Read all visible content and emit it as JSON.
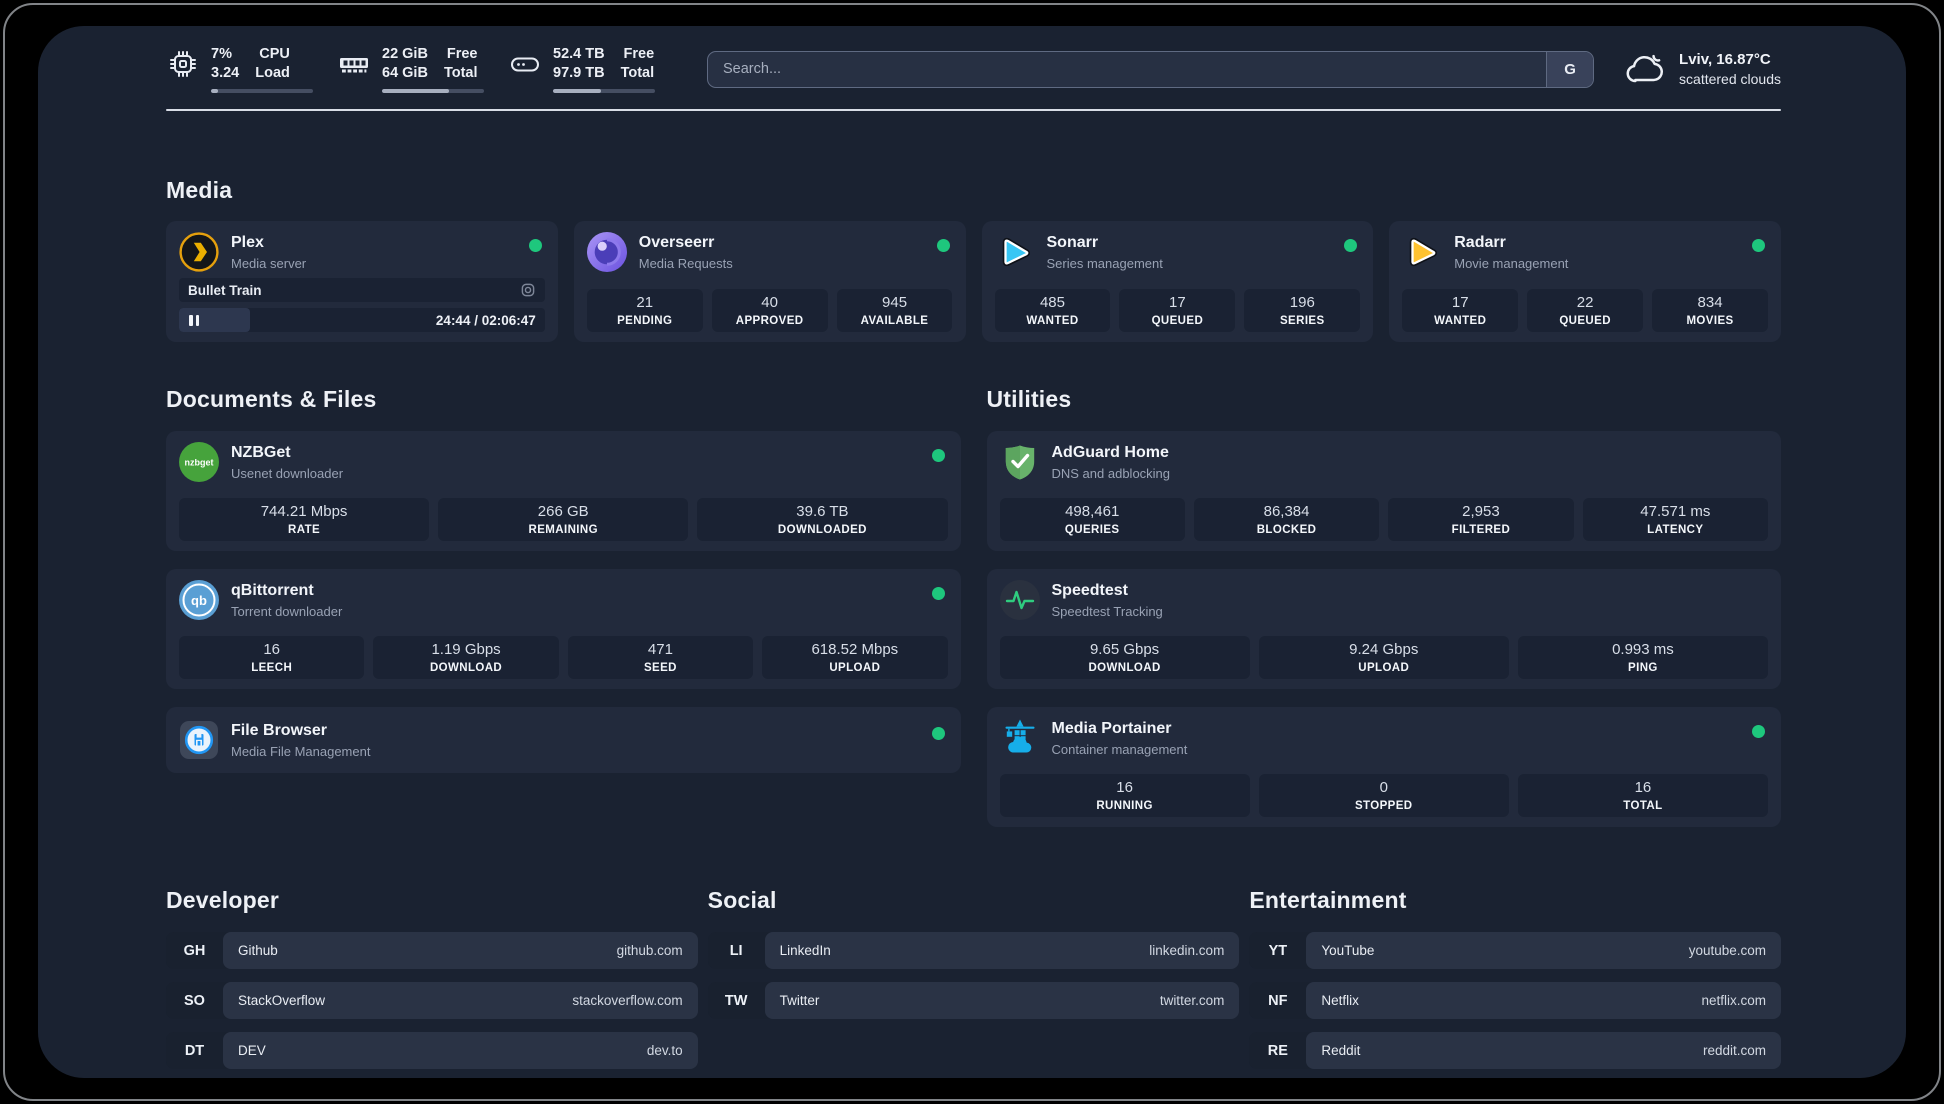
{
  "colors": {
    "page_bg": "#000000",
    "panel_bg": "#1A2231",
    "card_bg": "#222A3C",
    "tile_bg": "#1A2233",
    "status_online": "#1EC77D",
    "plex_orange": "#E5A00D",
    "sonarr_cyan": "#38C6F4",
    "radarr_yellow": "#FFC230",
    "nzbget_green": "#46A33C",
    "qbittorrent_blue": "#5A9FD4",
    "adguard_green": "#68B36B",
    "speedtest_green": "#2FCC7F",
    "portainer_blue": "#16AEEA",
    "overseerr_purple": "#6B52E0",
    "filebrowser_blue": "#2196F3"
  },
  "icons": {
    "nzbget_text": "nzbget",
    "qbittorrent_text": "qb"
  },
  "header": {
    "cpu": {
      "icon": "cpu-chip-icon",
      "value_top": "7%",
      "value_bottom": "3.24",
      "label_top": "CPU",
      "label_bottom": "Load",
      "progress_pct": 7
    },
    "memory": {
      "icon": "ram-icon",
      "value_top": "22 GiB",
      "value_bottom": "64 GiB",
      "label_top": "Free",
      "label_bottom": "Total",
      "progress_pct": 66
    },
    "disk": {
      "icon": "hard-drive-icon",
      "value_top": "52.4 TB",
      "value_bottom": "97.9 TB",
      "label_top": "Free",
      "label_bottom": "Total",
      "progress_pct": 47
    },
    "search": {
      "placeholder": "Search...",
      "button_label": "G"
    },
    "weather": {
      "icon": "cloud-icon",
      "location": "Lviv, 16.87°C",
      "condition": "scattered clouds"
    }
  },
  "media": {
    "title": "Media",
    "plex": {
      "icon": "plex-icon",
      "name": "Plex",
      "desc": "Media server",
      "status": "online",
      "now_playing": "Bullet Train",
      "elapsed_total": "24:44 / 02:06:47",
      "progress_pct": 19.5
    },
    "overseerr": {
      "icon": "overseerr-icon",
      "name": "Overseerr",
      "desc": "Media Requests",
      "status": "online",
      "stats": [
        {
          "value": "21",
          "label": "PENDING"
        },
        {
          "value": "40",
          "label": "APPROVED"
        },
        {
          "value": "945",
          "label": "AVAILABLE"
        }
      ]
    },
    "sonarr": {
      "icon": "sonarr-icon",
      "name": "Sonarr",
      "desc": "Series management",
      "status": "online",
      "stats": [
        {
          "value": "485",
          "label": "WANTED"
        },
        {
          "value": "17",
          "label": "QUEUED"
        },
        {
          "value": "196",
          "label": "SERIES"
        }
      ]
    },
    "radarr": {
      "icon": "radarr-icon",
      "name": "Radarr",
      "desc": "Movie management",
      "status": "online",
      "stats": [
        {
          "value": "17",
          "label": "WANTED"
        },
        {
          "value": "22",
          "label": "QUEUED"
        },
        {
          "value": "834",
          "label": "MOVIES"
        }
      ]
    }
  },
  "documents": {
    "title": "Documents & Files",
    "nzbget": {
      "icon": "nzbget-icon",
      "name": "NZBGet",
      "desc": "Usenet downloader",
      "status": "online",
      "stats": [
        {
          "value": "744.21 Mbps",
          "label": "RATE"
        },
        {
          "value": "266 GB",
          "label": "REMAINING"
        },
        {
          "value": "39.6 TB",
          "label": "DOWNLOADED"
        }
      ]
    },
    "qbittorrent": {
      "icon": "qbittorrent-icon",
      "name": "qBittorrent",
      "desc": "Torrent downloader",
      "status": "online",
      "stats": [
        {
          "value": "16",
          "label": "LEECH"
        },
        {
          "value": "1.19 Gbps",
          "label": "DOWNLOAD"
        },
        {
          "value": "471",
          "label": "SEED"
        },
        {
          "value": "618.52 Mbps",
          "label": "UPLOAD"
        }
      ]
    },
    "filebrowser": {
      "icon": "filebrowser-icon",
      "name": "File Browser",
      "desc": "Media File Management",
      "status": "online"
    }
  },
  "utilities": {
    "title": "Utilities",
    "adguard": {
      "icon": "adguard-icon",
      "name": "AdGuard Home",
      "desc": "DNS and adblocking",
      "stats": [
        {
          "value": "498,461",
          "label": "QUERIES"
        },
        {
          "value": "86,384",
          "label": "BLOCKED"
        },
        {
          "value": "2,953",
          "label": "FILTERED"
        },
        {
          "value": "47.571 ms",
          "label": "LATENCY"
        }
      ]
    },
    "speedtest": {
      "icon": "speedtest-icon",
      "name": "Speedtest",
      "desc": "Speedtest Tracking",
      "stats": [
        {
          "value": "9.65 Gbps",
          "label": "DOWNLOAD"
        },
        {
          "value": "9.24 Gbps",
          "label": "UPLOAD"
        },
        {
          "value": "0.993 ms",
          "label": "PING"
        }
      ]
    },
    "portainer": {
      "icon": "portainer-icon",
      "name": "Media Portainer",
      "desc": "Container management",
      "status": "online",
      "stats": [
        {
          "value": "16",
          "label": "RUNNING"
        },
        {
          "value": "0",
          "label": "STOPPED"
        },
        {
          "value": "16",
          "label": "TOTAL"
        }
      ]
    }
  },
  "links": {
    "developer": {
      "title": "Developer",
      "items": [
        {
          "abbr": "GH",
          "name": "Github",
          "url": "github.com"
        },
        {
          "abbr": "SO",
          "name": "StackOverflow",
          "url": "stackoverflow.com"
        },
        {
          "abbr": "DT",
          "name": "DEV",
          "url": "dev.to"
        }
      ]
    },
    "social": {
      "title": "Social",
      "items": [
        {
          "abbr": "LI",
          "name": "LinkedIn",
          "url": "linkedin.com"
        },
        {
          "abbr": "TW",
          "name": "Twitter",
          "url": "twitter.com"
        }
      ]
    },
    "entertainment": {
      "title": "Entertainment",
      "items": [
        {
          "abbr": "YT",
          "name": "YouTube",
          "url": "youtube.com"
        },
        {
          "abbr": "NF",
          "name": "Netflix",
          "url": "netflix.com"
        },
        {
          "abbr": "RE",
          "name": "Reddit",
          "url": "reddit.com"
        }
      ]
    }
  }
}
